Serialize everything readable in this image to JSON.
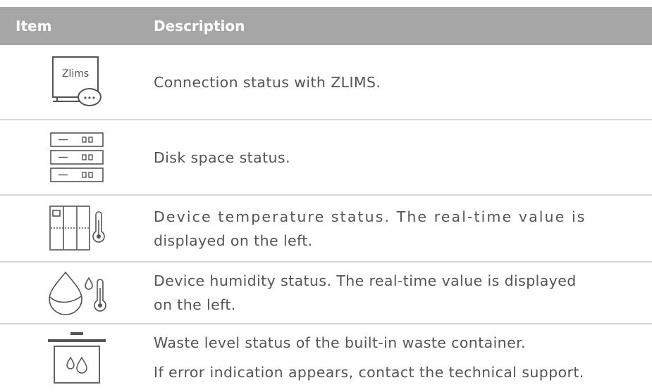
{
  "header": {
    "item_label": "Item",
    "description_label": "Description"
  },
  "rows": [
    {
      "icon": "zlims-connection-icon",
      "icon_text": "Zlims",
      "lines": [
        "Connection status with ZLIMS."
      ]
    },
    {
      "icon": "disk-space-icon",
      "lines": [
        "Disk space status."
      ]
    },
    {
      "icon": "device-temperature-icon",
      "lines": [
        "Device temperature status. The real-time value is",
        "displayed on the left."
      ]
    },
    {
      "icon": "device-humidity-icon",
      "lines": [
        "Device humidity status. The real-time value is displayed",
        "on the left."
      ]
    },
    {
      "icon": "waste-container-icon",
      "lines": [
        "Waste level status of the built-in waste container.",
        "If error indication appears, contact the technical support."
      ]
    }
  ],
  "colors": {
    "header_background": "#a6a6a6",
    "header_text": "#ffffff",
    "body_text": "#555555",
    "row_divider": "#d6d6d6",
    "icon_stroke": "#555555"
  }
}
